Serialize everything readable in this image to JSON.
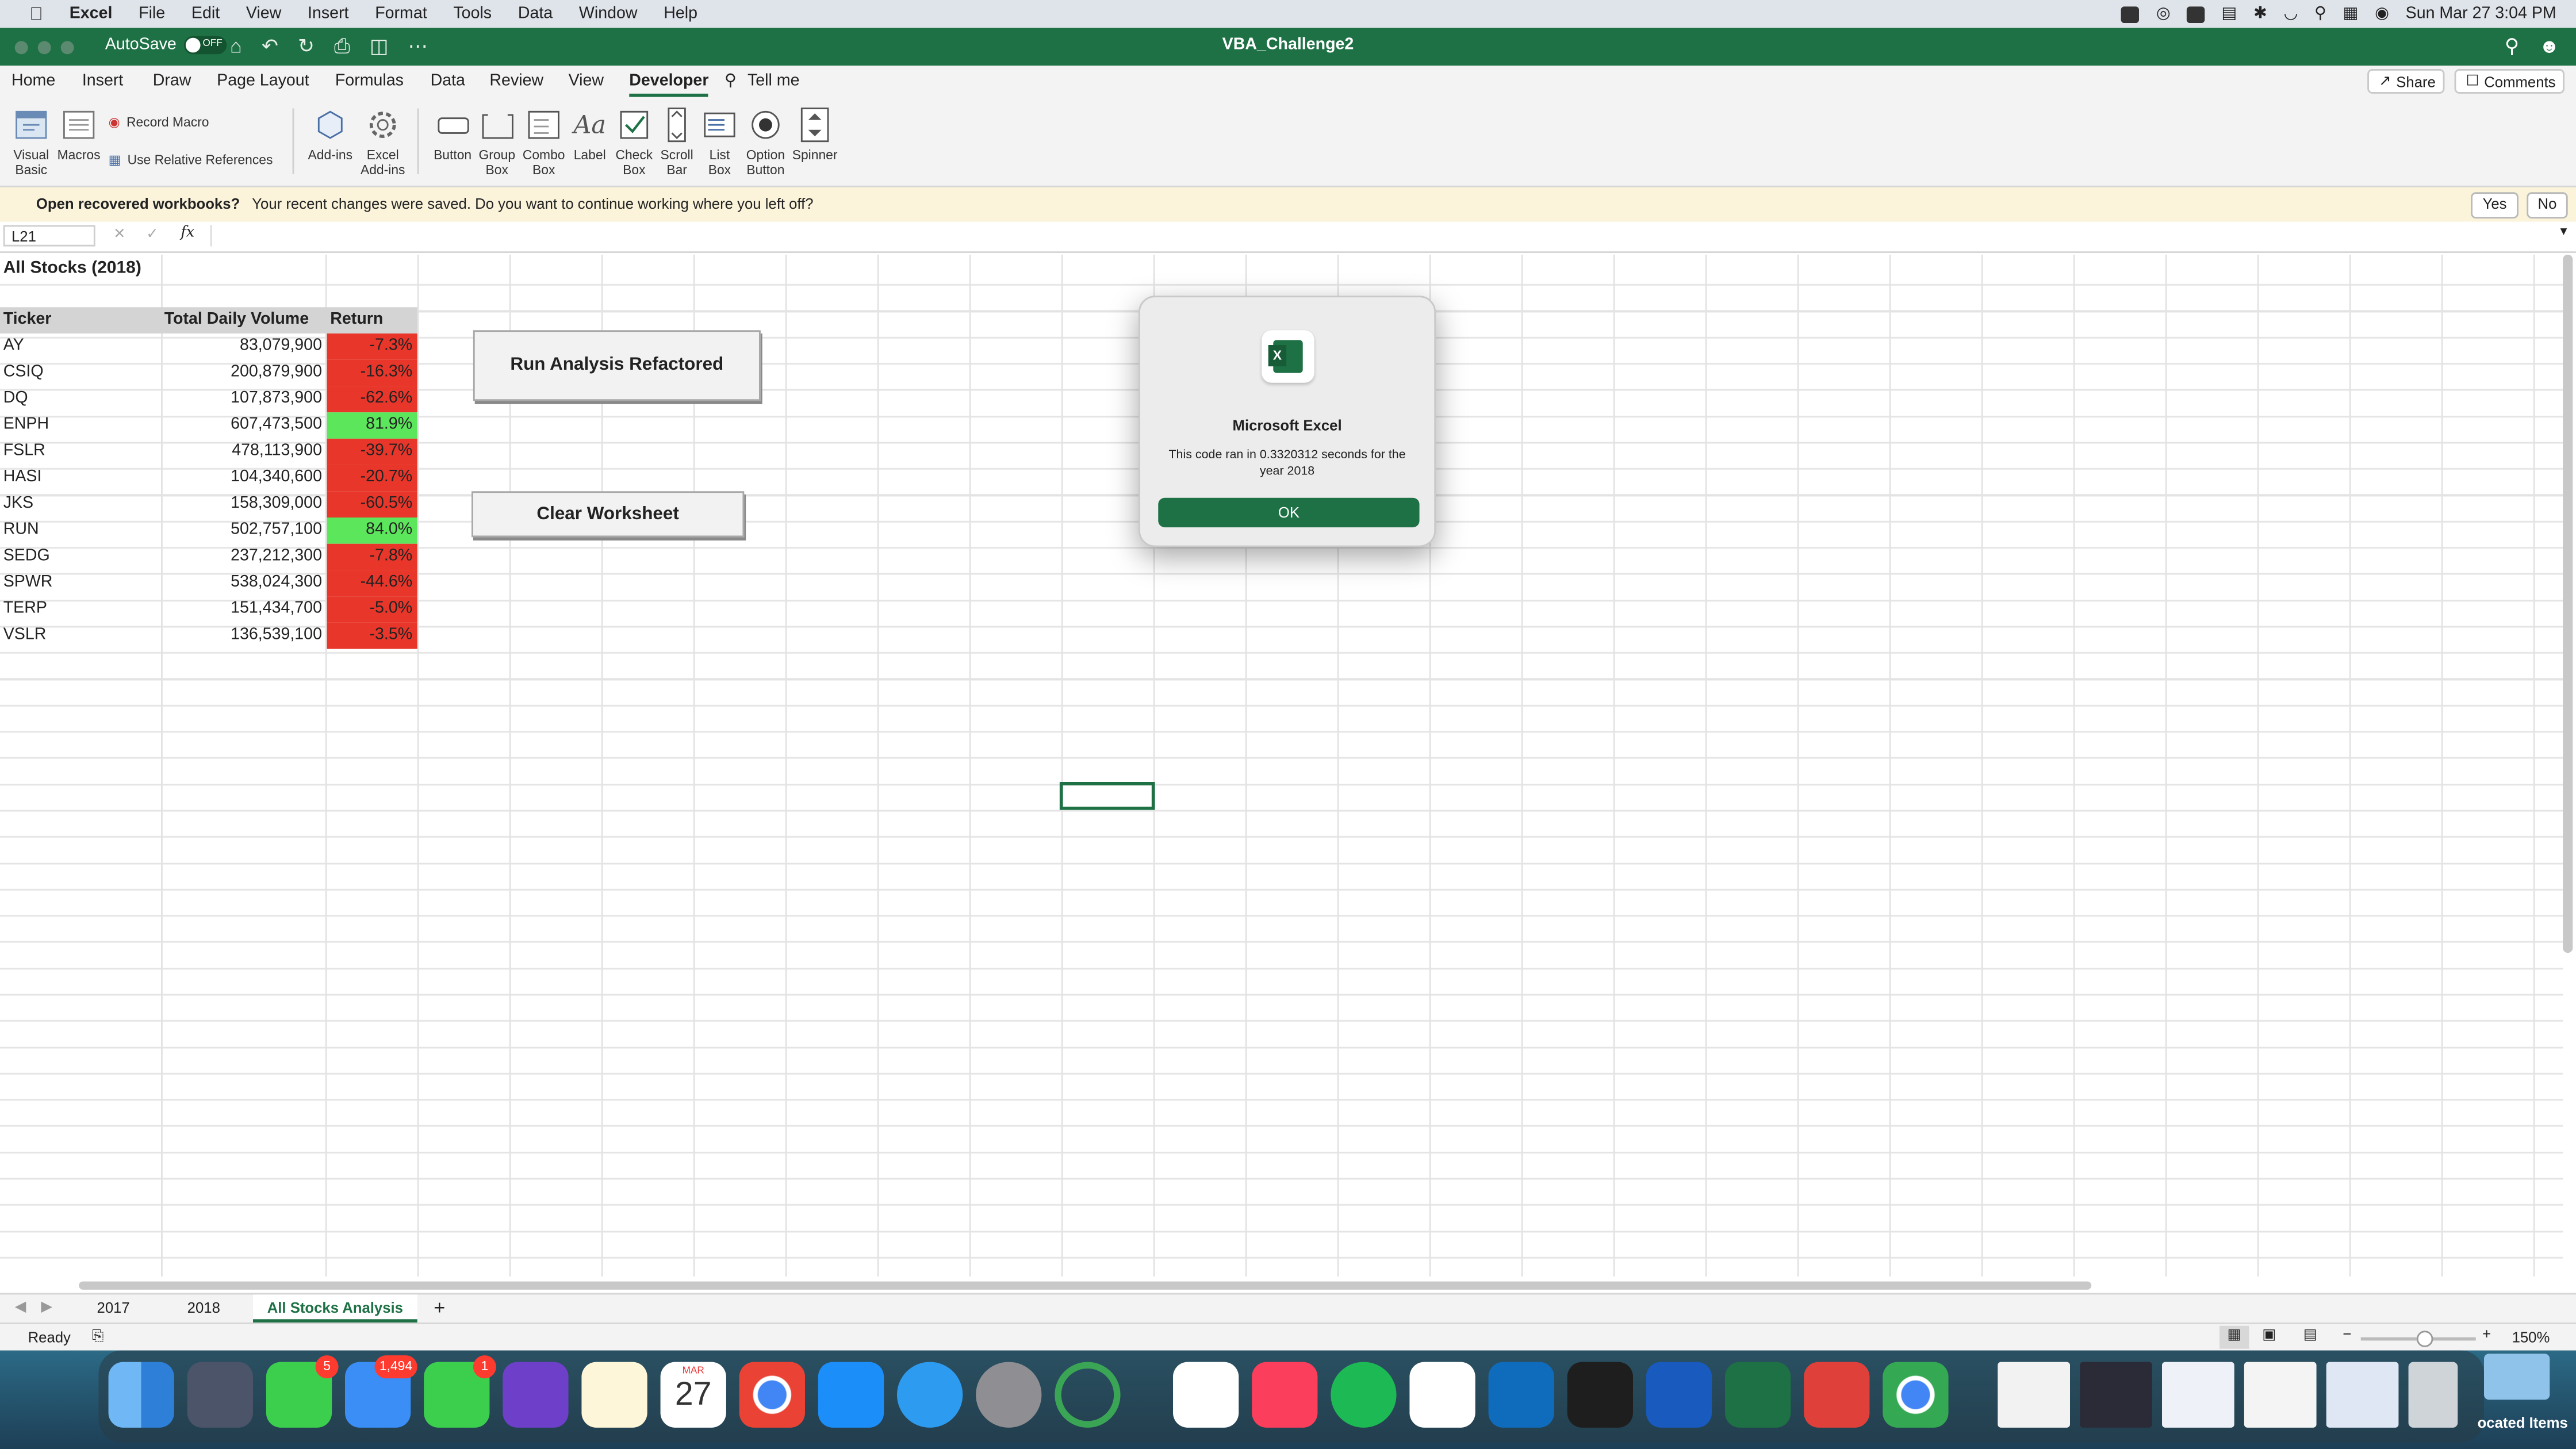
{
  "menubar": {
    "apple": "",
    "items": [
      "Excel",
      "File",
      "Edit",
      "View",
      "Insert",
      "Format",
      "Tools",
      "Data",
      "Window",
      "Help"
    ],
    "clock": "Sun Mar 27  3:04 PM"
  },
  "titlebar": {
    "autosave_label": "AutoSave",
    "autosave_state": "OFF",
    "doc_title": "VBA_Challenge2"
  },
  "ribbon": {
    "tabs": [
      "Home",
      "Insert",
      "Draw",
      "Page Layout",
      "Formulas",
      "Data",
      "Review",
      "View",
      "Developer",
      "Tell me"
    ],
    "share": "Share",
    "comments": "Comments",
    "tools": {
      "visual_basic": "Visual Basic",
      "macros": "Macros",
      "record_macro": "Record Macro",
      "use_relative": "Use Relative References",
      "addins": "Add-ins",
      "excel_addins": "Excel Add-ins",
      "button": "Button",
      "group_box": "Group Box",
      "combo_box": "Combo Box",
      "label": "Label",
      "check_box": "Check Box",
      "scroll_bar": "Scroll Bar",
      "list_box": "List Box",
      "option_button": "Option Button",
      "spinner": "Spinner"
    }
  },
  "notification": {
    "title": "Open recovered workbooks?",
    "message": "Your recent changes were saved. Do you want to continue working where you left off?",
    "yes": "Yes",
    "no": "No"
  },
  "formula_bar": {
    "name_box": "L21",
    "fx": "fx",
    "value": ""
  },
  "sheet": {
    "title": "All Stocks (2018)",
    "headers": [
      "Ticker",
      "Total Daily Volume",
      "Return"
    ],
    "rows": [
      {
        "ticker": "AY",
        "volume": "83,079,900",
        "ret": "-7.3%",
        "positive": false
      },
      {
        "ticker": "CSIQ",
        "volume": "200,879,900",
        "ret": "-16.3%",
        "positive": false
      },
      {
        "ticker": "DQ",
        "volume": "107,873,900",
        "ret": "-62.6%",
        "positive": false
      },
      {
        "ticker": "ENPH",
        "volume": "607,473,500",
        "ret": "81.9%",
        "positive": true
      },
      {
        "ticker": "FSLR",
        "volume": "478,113,900",
        "ret": "-39.7%",
        "positive": false
      },
      {
        "ticker": "HASI",
        "volume": "104,340,600",
        "ret": "-20.7%",
        "positive": false
      },
      {
        "ticker": "JKS",
        "volume": "158,309,000",
        "ret": "-60.5%",
        "positive": false
      },
      {
        "ticker": "RUN",
        "volume": "502,757,100",
        "ret": "84.0%",
        "positive": true
      },
      {
        "ticker": "SEDG",
        "volume": "237,212,300",
        "ret": "-7.8%",
        "positive": false
      },
      {
        "ticker": "SPWR",
        "volume": "538,024,300",
        "ret": "-44.6%",
        "positive": false
      },
      {
        "ticker": "TERP",
        "volume": "151,434,700",
        "ret": "-5.0%",
        "positive": false
      },
      {
        "ticker": "VSLR",
        "volume": "136,539,100",
        "ret": "-3.5%",
        "positive": false
      }
    ],
    "buttons": {
      "run": "Run Analysis Refactored",
      "clear": "Clear Worksheet"
    },
    "colors": {
      "negative": "#e8362a",
      "positive": "#5ce65c"
    }
  },
  "dialog": {
    "title": "Microsoft Excel",
    "message": "This code ran in 0.3320312 seconds for the year 2018",
    "ok": "OK"
  },
  "sheet_tabs": [
    "2017",
    "2018",
    "All Stocks Analysis"
  ],
  "active_sheet": "All Stocks Analysis",
  "status": {
    "ready": "Ready",
    "zoom": "150%"
  },
  "dock": {
    "badges": {
      "messages": "5",
      "mail": "1,494",
      "facetime": "1"
    },
    "calendar_month": "MAR",
    "calendar_day": "27",
    "recent_label": "ocated Items"
  },
  "colors": {
    "excel_green": "#1e7145"
  }
}
